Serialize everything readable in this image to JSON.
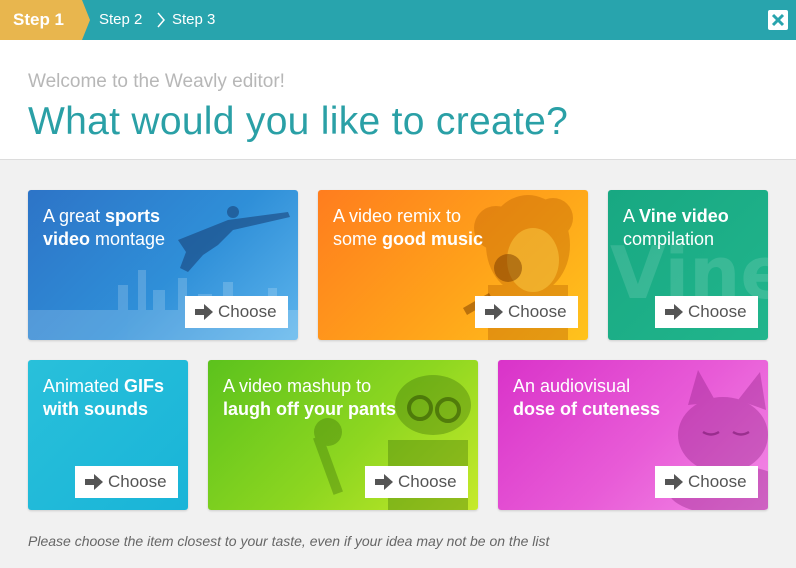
{
  "stepbar": {
    "steps": [
      {
        "label": "Step 1"
      },
      {
        "label": "Step 2"
      },
      {
        "label": "Step 3"
      }
    ],
    "close_icon": "close-icon"
  },
  "header": {
    "welcome": "Welcome to the Weavly editor!",
    "headline": "What would you like to create?"
  },
  "cards": [
    {
      "pre": "A great ",
      "bold": "sports",
      "line2_bold": "video",
      "line2": " montage",
      "button": "Choose"
    },
    {
      "pre": "A video remix to",
      "line2": "some ",
      "line2_bold": "good music",
      "button": "Choose"
    },
    {
      "pre": "A ",
      "bold": "Vine video",
      "line2": "compilation",
      "watermark": "Vine",
      "button": "Choose"
    },
    {
      "pre": "Animated ",
      "bold": "GIFs",
      "line2_bold": "with sounds",
      "button": "Choose"
    },
    {
      "pre": "A video mashup to",
      "line2_bold": "laugh off your pants",
      "button": "Choose"
    },
    {
      "pre": "An audiovisual",
      "line2_bold": "dose of cuteness",
      "button": "Choose"
    }
  ],
  "footer": {
    "note": "Please choose the item closest to your taste, even if your idea may not be on the list"
  },
  "colors": {
    "teal": "#28a4ad",
    "step_active": "#e8b64e",
    "headline": "#2aa0a6"
  }
}
